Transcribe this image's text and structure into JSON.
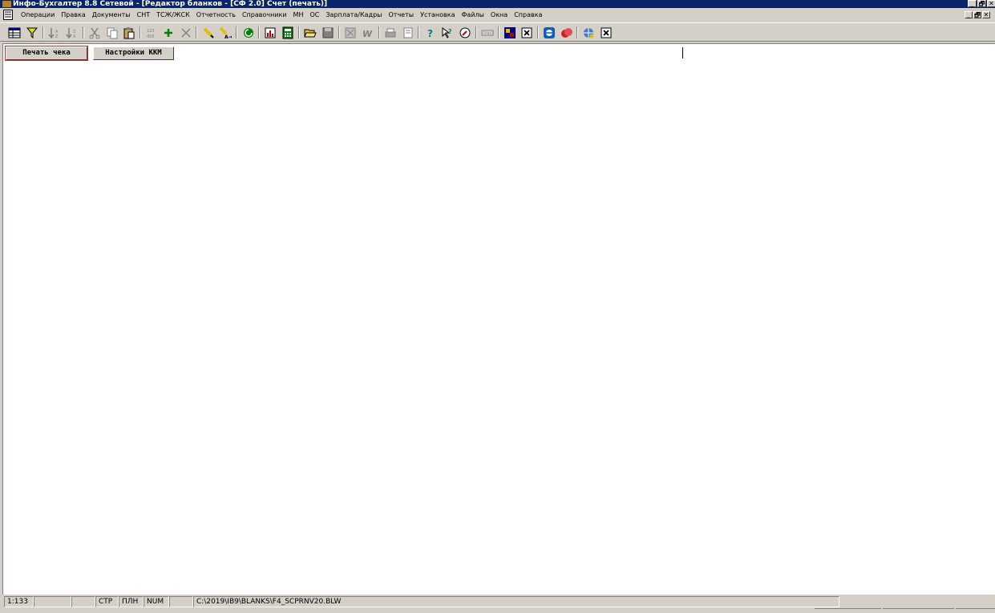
{
  "window": {
    "title": "Инфо-Бухгалтер 8.8 Сетевой - [Редактор бланков - [СФ 2.0] Счет (печать)]",
    "buttons": {
      "minimize": "_",
      "maximize": "🗗",
      "close": "✕"
    }
  },
  "menu": {
    "items": [
      "Операции",
      "Правка",
      "Документы",
      "СНТ",
      "ТСЖ/ЖСК",
      "Отчетность",
      "Справочники",
      "МН",
      "ОС",
      "Зарплата/Кадры",
      "Отчеты",
      "Установка",
      "Файлы",
      "Окна",
      "Справка"
    ],
    "mdi_buttons": {
      "minimize": "_",
      "restore": "🗗",
      "close": "✕"
    }
  },
  "toolbar": {
    "icons": [
      "table-icon",
      "filter-icon",
      "sort-asc-icon",
      "sort-desc-icon",
      "cut-icon",
      "copy-icon",
      "paste-icon",
      "number-icon",
      "add-icon",
      "delete-icon",
      "pencil-icon",
      "replace-icon",
      "refresh-icon",
      "chart-icon",
      "calculator-icon",
      "open-folder-icon",
      "save-icon",
      "form-icon",
      "word-icon",
      "print-icon",
      "preview-icon",
      "help-icon",
      "context-help-icon",
      "compass-icon",
      "tag-icon",
      "matrix-icon",
      "close-doc-icon",
      "teamviewer-icon",
      "support-icon",
      "web-icon",
      "close-icon"
    ]
  },
  "document": {
    "buttons": {
      "print_receipt": "Печать чека",
      "kkm_settings": "Настройки ККМ"
    }
  },
  "status": {
    "position": "1:133",
    "panel2": "",
    "panel3": "",
    "caps": "СТР",
    "mode": "ПЛН",
    "num": "NUM",
    "panel7": "",
    "file_path": "C:\\2019\\IB9\\BLANKS\\F4_SCPRNV20.BLW"
  }
}
